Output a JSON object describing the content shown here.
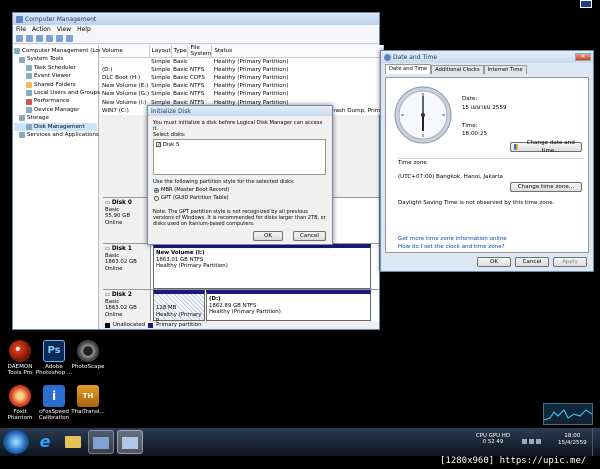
{
  "top_icon": "pc-icon",
  "computer_mgmt": {
    "title": "Computer Management",
    "menu": [
      "File",
      "Action",
      "View",
      "Help"
    ],
    "tree": [
      {
        "label": "Computer Management (Local",
        "indent": 0
      },
      {
        "label": "System Tools",
        "indent": 1
      },
      {
        "label": "Task Scheduler",
        "indent": 2
      },
      {
        "label": "Event Viewer",
        "indent": 2
      },
      {
        "label": "Shared Folders",
        "indent": 2
      },
      {
        "label": "Local Users and Groups",
        "indent": 2
      },
      {
        "label": "Performance",
        "indent": 2
      },
      {
        "label": "Device Manager",
        "indent": 2
      },
      {
        "label": "Storage",
        "indent": 1
      },
      {
        "label": "Disk Management",
        "indent": 2
      },
      {
        "label": "Services and Applications",
        "indent": 1
      }
    ],
    "columns": [
      "Volume",
      "Layout",
      "Type",
      "File System",
      "Status"
    ],
    "rows": [
      [
        "",
        "Simple",
        "Basic",
        "",
        "Healthy (Primary Partition)"
      ],
      [
        "(D:)",
        "Simple",
        "Basic",
        "NTFS",
        "Healthy (Primary Partition)"
      ],
      [
        "DLC Boot (H:)",
        "Simple",
        "Basic",
        "CDFS",
        "Healthy (Primary Partition)"
      ],
      [
        "New Volume (E:)",
        "Simple",
        "Basic",
        "NTFS",
        "Healthy (Primary Partition)"
      ],
      [
        "New Volume (G:)",
        "Simple",
        "Basic",
        "NTFS",
        "Healthy (Primary Partition)"
      ],
      [
        "New Volume (I:)",
        "Simple",
        "Basic",
        "NTFS",
        "Healthy (Primary Partition)"
      ],
      [
        "WIN7 (C:)",
        "Simple",
        "Basic",
        "NTFS",
        "Healthy (System, Boot, Page File, Active, Crash Dump, Prima"
      ]
    ],
    "disks": [
      {
        "name": "Disk 0",
        "lines": [
          "Basic",
          "55.90 GB",
          "Online"
        ]
      },
      {
        "name": "Disk 1",
        "lines": [
          "Basic",
          "1863.02 GB",
          "Online"
        ],
        "part_title": "New Volume (I:)",
        "part_lines": [
          "1863.01 GB NTFS",
          "Healthy (Primary Partition)"
        ]
      },
      {
        "name": "Disk 2",
        "lines": [
          "Basic",
          "1863.02 GB",
          "Online"
        ],
        "part_a": [
          "128 MB",
          "Healthy (Primary P"
        ],
        "part_b_title": "(D:)",
        "part_b_lines": [
          "1862.89 GB NTFS",
          "Healthy (Primary Partition)"
        ]
      }
    ],
    "legend": [
      "Unallocated",
      "Primary partition"
    ]
  },
  "init_disk": {
    "title": "Initialize Disk",
    "intro": "You must initialize a disk before Logical Disk Manager can access it.",
    "select_label": "Select disks:",
    "disk_item": "Disk 5",
    "style_label": "Use the following partition style for the selected disks:",
    "option_mbr": "MBR (Master Boot Record)",
    "option_gpt": "GPT (GUID Partition Table)",
    "note": "Note: The GPT partition style is not recognized by all previous versions of Windows. It is recommended for disks larger than 2TB, or disks used on Itanium-based computers.",
    "ok": "OK",
    "cancel": "Cancel"
  },
  "datetime": {
    "title": "Date and Time",
    "tabs": [
      "Date and Time",
      "Additional Clocks",
      "Internet Time"
    ],
    "date_label": "Date:",
    "date_value": "15 เมษายน 2559",
    "time_label": "Time:",
    "time_value": "18:00:25",
    "change_dt": "Change date and time...",
    "tz_label": "Time zone",
    "tz_value": "(UTC+07:00) Bangkok, Hanoi, Jakarta",
    "change_tz": "Change time zone...",
    "dst": "Daylight Saving Time is not observed by this time zone.",
    "link1": "Get more time zone information online",
    "link2": "How do I set the clock and time zone?",
    "ok": "OK",
    "cancel": "Cancel",
    "apply": "Apply"
  },
  "desktop_icons": [
    {
      "label": "DAEMON Tools Pro",
      "color": "#e23a1a"
    },
    {
      "label": "Adobe Photoshop ...",
      "color": "#0b2a55"
    },
    {
      "label": "PhotoScape",
      "color": "#555"
    },
    {
      "label": "Foxit Phantom",
      "color": "#d2391d"
    },
    {
      "label": "cFosSpeed Calibration",
      "color": "#2a6fd0"
    },
    {
      "label": "ThaiTransl...",
      "color": "#e0a020"
    }
  ],
  "tray": {
    "cpu_gpu": "CPU GPU HD",
    "vals": "0   52  49",
    "clock_time": "18:00",
    "clock_date": "15/4/2559",
    "watermark": "[1280x960] https://upic.me/"
  },
  "colors": {
    "partition_bar": "#1a1a7a",
    "desktop": "#000000"
  }
}
